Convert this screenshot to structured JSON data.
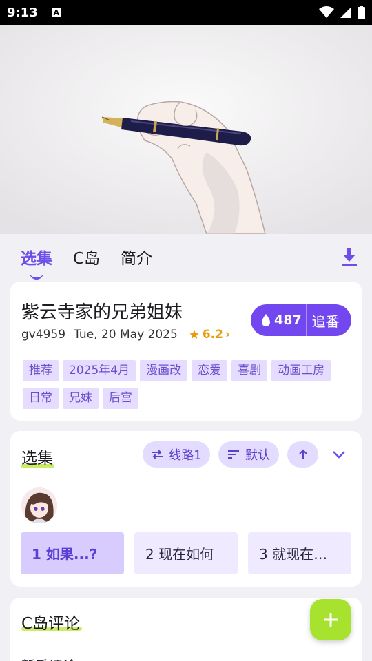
{
  "status": {
    "time": "9:13",
    "notification_icon": "A"
  },
  "tabs": [
    {
      "label": "选集",
      "active": true
    },
    {
      "label": "C岛",
      "active": false
    },
    {
      "label": "简介",
      "active": false
    }
  ],
  "info": {
    "title": "紫云寺家的兄弟姐妹",
    "id": "gv4959",
    "date": "Tue, 20 May 2025",
    "rating": "6.2",
    "follow_count": "487",
    "follow_label": "追番",
    "tags": [
      "推荐",
      "2025年4月",
      "漫画改",
      "恋爱",
      "喜剧",
      "动画工房",
      "日常",
      "兄妹",
      "后宫"
    ]
  },
  "episodes_section": {
    "title": "选集",
    "route_label": "线路1",
    "sort_label": "默认",
    "episodes": [
      {
        "label": "1 如果...?",
        "selected": true
      },
      {
        "label": "2 现在如何",
        "selected": false
      },
      {
        "label": "3 就现在…",
        "selected": false
      }
    ]
  },
  "comments_section": {
    "title": "C岛评论",
    "sub_label": "新番评论"
  },
  "colors": {
    "accent": "#7247f0",
    "tag_bg": "#e6dcff",
    "fab": "#a6e22e",
    "rating": "#e59d0e"
  }
}
